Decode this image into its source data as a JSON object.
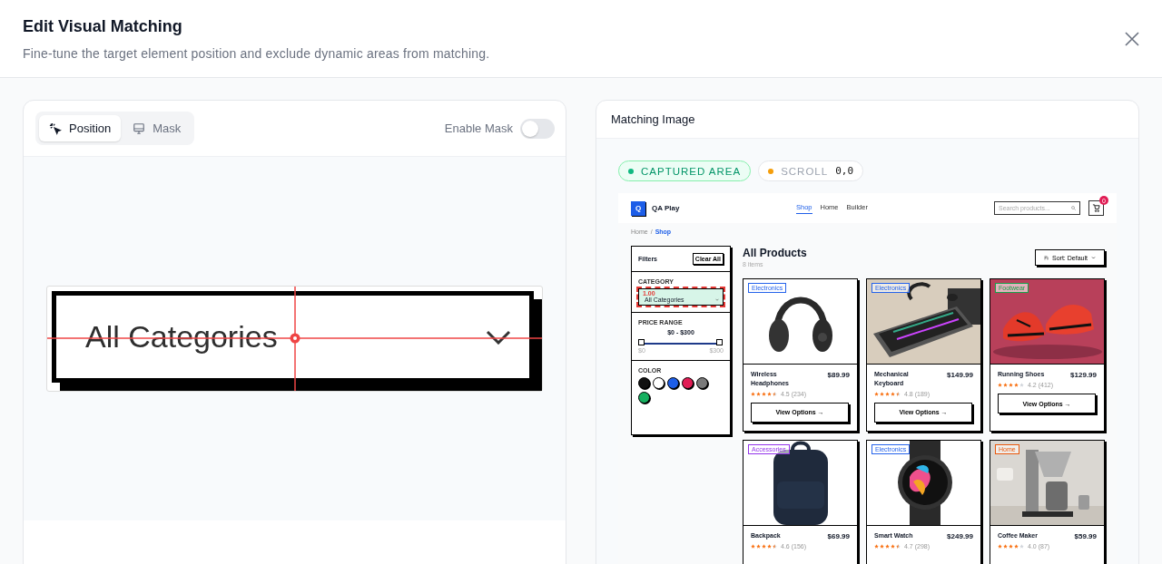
{
  "dialog": {
    "title": "Edit Visual Matching",
    "subtitle": "Fine-tune the target element position and exclude dynamic areas from matching."
  },
  "editor": {
    "tabs": [
      {
        "label": "Position",
        "selected": true
      },
      {
        "label": "Mask",
        "selected": false
      }
    ],
    "mask_toggle": {
      "label": "Enable Mask",
      "on": false
    },
    "preview": {
      "text": "All Categories"
    }
  },
  "matching": {
    "title": "Matching Image",
    "badges": [
      {
        "kind": "captured",
        "label": "CAPTURED AREA"
      },
      {
        "kind": "scroll",
        "label": "SCROLL",
        "value": "0,0"
      }
    ],
    "screenshot": {
      "logo": {
        "mark": "Q",
        "name": "QA Play"
      },
      "nav": [
        {
          "label": "Shop",
          "selected": true
        },
        {
          "label": "Home",
          "selected": false
        },
        {
          "label": "Builder",
          "selected": false
        }
      ],
      "search_placeholder": "Search products...",
      "cart_count": "0",
      "breadcrumb": [
        {
          "label": "Home",
          "selected": false
        },
        {
          "label": "Shop",
          "selected": true
        }
      ],
      "breadcrumb_separator": "/",
      "filters": {
        "title": "Filters",
        "clear": "Clear All",
        "category": {
          "label": "CATEGORY",
          "value": "All Categories",
          "highlighted": true,
          "score": "1.00"
        },
        "price": {
          "label": "PRICE RANGE",
          "range": "$0 - $300",
          "thumbs": [
            {
              "level": 0
            },
            {
              "level": 1
            }
          ],
          "min": "$0",
          "max": "$300"
        },
        "color": {
          "label": "COLOR",
          "swatches": [
            {
              "color": "#111111"
            },
            {
              "color": "#ffffff"
            },
            {
              "color": "#1d5ee8"
            },
            {
              "color": "#e11d55"
            },
            {
              "color": "#7a7a7a"
            },
            {
              "color": "#16b060"
            }
          ]
        }
      },
      "heading": "All Products",
      "count": "8 items",
      "sort": "Sort: Default",
      "products": [
        {
          "tag": {
            "label": "Electronics",
            "color": "#2563eb"
          },
          "name": "Wireless Headphones",
          "price": "$89.99",
          "stars": 4.5,
          "rating": "4.5 (234)",
          "button": "View Options →"
        },
        {
          "tag": {
            "label": "Electronics",
            "color": "#2563eb"
          },
          "name": "Mechanical Keyboard",
          "price": "$149.99",
          "stars": 4.5,
          "rating": "4.8 (189)",
          "button": "View Options →"
        },
        {
          "tag": {
            "label": "Footwear",
            "color": "#16a34a"
          },
          "name": "Running Shoes",
          "price": "$129.99",
          "stars": 4,
          "rating": "4.2 (412)",
          "button": "View Options →"
        },
        {
          "tag": {
            "label": "Accessories",
            "color": "#9333ea"
          },
          "name": "Backpack",
          "price": "$69.99",
          "stars": 4.5,
          "rating": "4.6 (156)"
        },
        {
          "tag": {
            "label": "Electronics",
            "color": "#2563eb"
          },
          "name": "Smart Watch",
          "price": "$249.99",
          "stars": 4.5,
          "rating": "4.7 (298)"
        },
        {
          "tag": {
            "label": "Home",
            "color": "#ea580c"
          },
          "name": "Coffee Maker",
          "price": "$59.99",
          "stars": 4,
          "rating": "4.0 (87)"
        }
      ]
    }
  }
}
